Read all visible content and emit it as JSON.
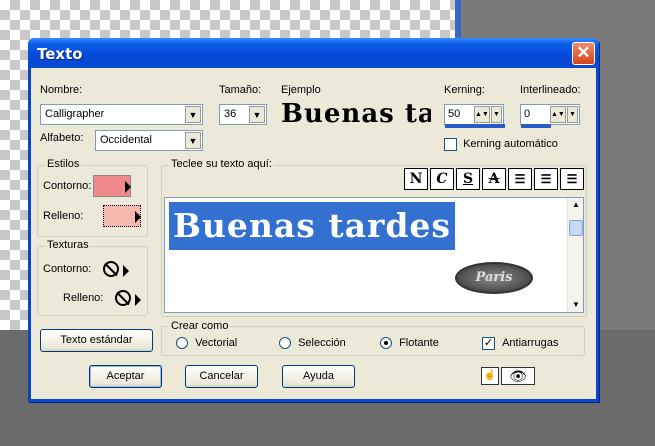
{
  "dialog": {
    "title": "Texto"
  },
  "font": {
    "name_label": "Nombre:",
    "name_value": "Calligrapher",
    "size_label": "Tamaño:",
    "size_value": "36",
    "alphabet_label": "Alfabeto:",
    "alphabet_value": "Occidental"
  },
  "example": {
    "label": "Ejemplo",
    "text": "Buenas tai"
  },
  "kerning": {
    "label": "Kerning:",
    "value": "50",
    "auto_label": "Kerning automático",
    "auto_checked": false
  },
  "interlineado": {
    "label": "Interlineado:",
    "value": "0"
  },
  "estilos": {
    "title": "Estilos",
    "contorno_label": "Contorno:",
    "relleno_label": "Relleno:",
    "contorno_color": "#f08a8a",
    "relleno_color": "#f6b9b0"
  },
  "texturas": {
    "title": "Texturas",
    "contorno_label": "Contorno:",
    "relleno_label": "Relleno:"
  },
  "text_entry": {
    "label": "Teclee su texto aquí:",
    "value": "Buenas tardes"
  },
  "format_buttons": [
    "N",
    "C",
    "S",
    "A"
  ],
  "logo_text": "Paris",
  "standard_button": "Texto estándar",
  "crear_como": {
    "title": "Crear como",
    "options": [
      {
        "label": "Vectorial",
        "selected": false
      },
      {
        "label": "Selección",
        "selected": false
      },
      {
        "label": "Flotante",
        "selected": true
      }
    ],
    "antialias_label": "Antiarrugas",
    "antialias_checked": true
  },
  "buttons": {
    "accept": "Aceptar",
    "cancel": "Cancelar",
    "help": "Ayuda"
  },
  "colors": {
    "selection": "#3470d0",
    "title_bar": "#0a5ee8",
    "dialog_bg": "#ece9d8"
  }
}
